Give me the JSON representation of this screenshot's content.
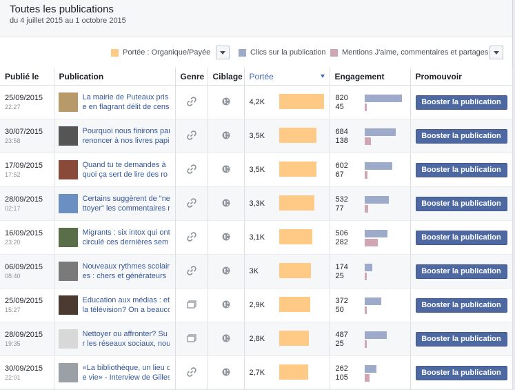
{
  "header": {
    "title": "Toutes les publications",
    "subtitle": "du 4 juillet 2015 au 1 octobre 2015"
  },
  "legend": [
    {
      "label": "Portée : Organique/Payée",
      "color": "#ffca86"
    },
    {
      "label": "Clics sur la publication",
      "color": "#9daac9"
    },
    {
      "label": "Mentions J'aime, commentaires et partages",
      "color": "#d0a6b5"
    }
  ],
  "columns": {
    "date": "Publié le",
    "publication": "Publication",
    "genre": "Genre",
    "ciblage": "Ciblage",
    "portee": "Portée",
    "engagement": "Engagement",
    "promouvoir": "Promouvoir"
  },
  "colors": {
    "reach": "#ffca86",
    "clicks": "#9daac9",
    "likes": "#d0a6b5",
    "boost": "#4e69a2",
    "link": "#365899"
  },
  "boost_label": "Booster la publication",
  "rows": [
    {
      "date": "25/09/2015",
      "time": "22:27",
      "line1": "La mairie de Puteaux pris",
      "line2": "e en flagrant délit de cens",
      "genre": "link-icon",
      "reach": "4,2K",
      "reach_value": 4200,
      "clicks": "820",
      "clicks_value": 820,
      "likes": "45",
      "likes_value": 45,
      "thumb": "#b89a6a"
    },
    {
      "date": "30/07/2015",
      "time": "23:58",
      "line1": "Pourquoi nous finirons par",
      "line2": "renoncer à nos livres papi",
      "genre": "link-icon",
      "reach": "3,5K",
      "reach_value": 3500,
      "clicks": "684",
      "clicks_value": 684,
      "likes": "138",
      "likes_value": 138,
      "thumb": "#555555"
    },
    {
      "date": "17/09/2015",
      "time": "17:52",
      "line1": "Quand tu te demandes à",
      "line2": "quoi ça sert de lire des ro",
      "genre": "link-icon",
      "reach": "3,5K",
      "reach_value": 3500,
      "clicks": "602",
      "clicks_value": 602,
      "likes": "67",
      "likes_value": 67,
      "thumb": "#8a4a3a"
    },
    {
      "date": "28/09/2015",
      "time": "02:17",
      "line1": "Certains suggèrent de \"ne",
      "line2": "ttoyer\" les commentaires r",
      "genre": "link-icon",
      "reach": "3,3K",
      "reach_value": 3300,
      "clicks": "532",
      "clicks_value": 532,
      "likes": "77",
      "likes_value": 77,
      "thumb": "#6a8fc0"
    },
    {
      "date": "16/09/2015",
      "time": "23:20",
      "line1": "Migrants : six intox qui ont",
      "line2": "circulé ces dernières sem",
      "genre": "link-icon",
      "reach": "3,1K",
      "reach_value": 3100,
      "clicks": "506",
      "clicks_value": 506,
      "likes": "282",
      "likes_value": 282,
      "thumb": "#5a6e4a"
    },
    {
      "date": "06/09/2015",
      "time": "08:40",
      "line1": "Nouveaux rythmes scolair",
      "line2": "es : chers et générateurs",
      "genre": "link-icon",
      "reach": "3K",
      "reach_value": 3000,
      "clicks": "174",
      "clicks_value": 174,
      "likes": "25",
      "likes_value": 25,
      "thumb": "#7a7a7a"
    },
    {
      "date": "25/09/2015",
      "time": "15:27",
      "line1": "Education aux médias : et",
      "line2": "la télévision? On a beauco",
      "genre": "photo-icon",
      "reach": "2,9K",
      "reach_value": 2900,
      "clicks": "372",
      "clicks_value": 372,
      "likes": "50",
      "likes_value": 50,
      "thumb": "#4a3a30"
    },
    {
      "date": "28/09/2015",
      "time": "19:35",
      "line1": "Nettoyer ou affronter? Su",
      "line2": "r les réseaux sociaux, nou",
      "genre": "photo-icon",
      "reach": "2,8K",
      "reach_value": 2800,
      "clicks": "487",
      "clicks_value": 487,
      "likes": "25",
      "likes_value": 25,
      "thumb": "#d8d8d8"
    },
    {
      "date": "30/09/2015",
      "time": "22:01",
      "line1": "«La bibliothèque, un lieu d",
      "line2": "e vie» - Interview de Gilles",
      "genre": "link-icon",
      "reach": "2,7K",
      "reach_value": 2700,
      "clicks": "262",
      "clicks_value": 262,
      "likes": "105",
      "likes_value": 105,
      "thumb": "#9aa0a6"
    }
  ]
}
